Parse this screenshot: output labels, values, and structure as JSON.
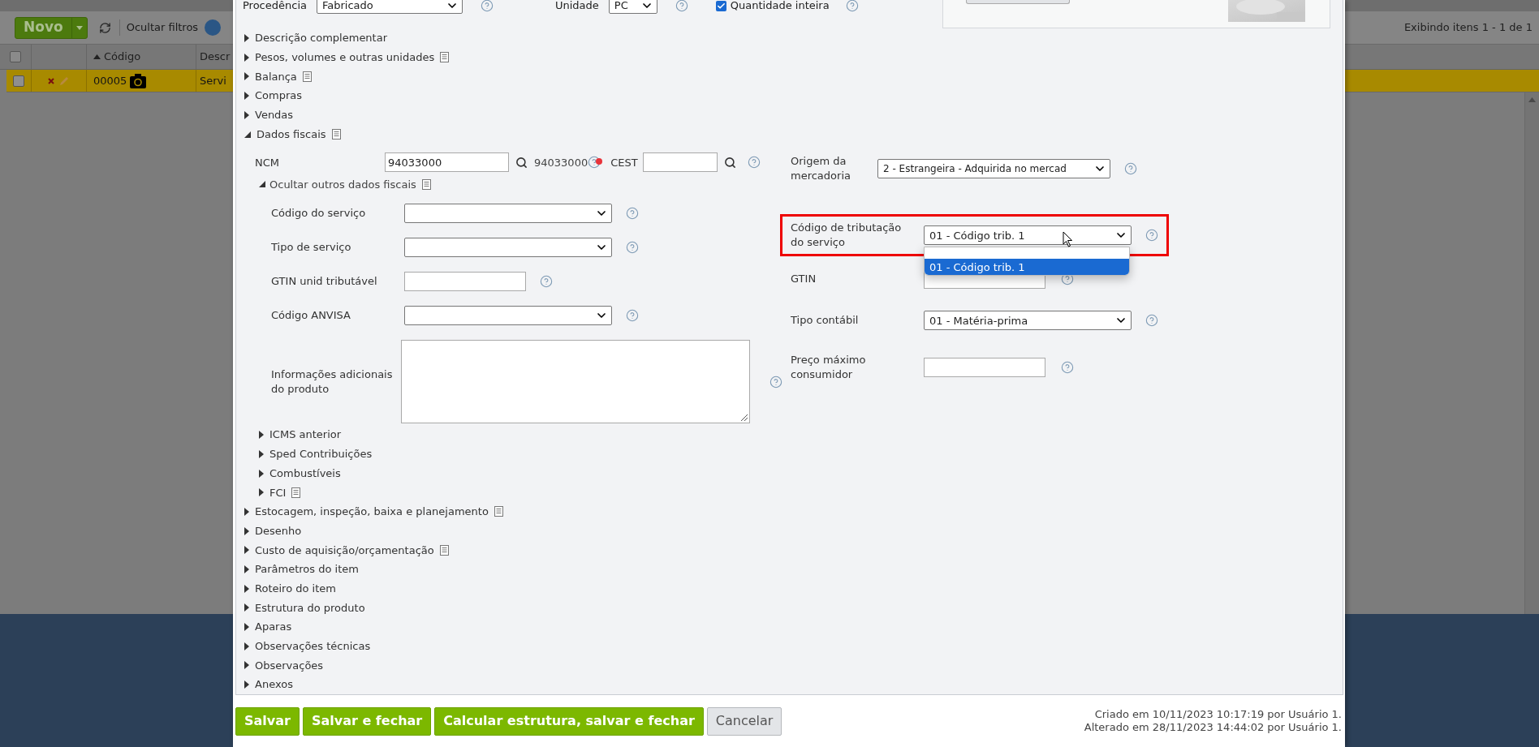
{
  "list_page": {
    "toolbar": {
      "new_button": "Novo",
      "hide_filters_button": "Ocultar filtros"
    },
    "pager": "Exibindo itens 1 - 1 de 1",
    "table": {
      "select_all_checked": false,
      "columns": [
        {
          "label": "Código",
          "sorted": true
        },
        {
          "label": "Descr",
          "sorted": false
        }
      ],
      "rows": [
        {
          "checked": false,
          "selected": true,
          "code": "00005",
          "description": "Servi"
        }
      ]
    }
  },
  "dialog": {
    "top_fields": [
      {
        "label": "Procedência",
        "kind": "select",
        "value": "Fabricado"
      },
      {
        "label": "Unidade",
        "kind": "select",
        "value": "PC"
      },
      {
        "label": "Quantidade inteira",
        "kind": "checkbox",
        "checked": true
      }
    ],
    "sections": [
      {
        "label": "Descrição complementar",
        "expanded": false,
        "note": false
      },
      {
        "label": "Pesos, volumes e outras unidades",
        "expanded": false,
        "note": true
      },
      {
        "label": "Balança",
        "expanded": false,
        "note": true
      },
      {
        "label": "Compras",
        "expanded": false,
        "note": false
      },
      {
        "label": "Vendas",
        "expanded": false,
        "note": false
      },
      {
        "label": "Dados fiscais",
        "expanded": true,
        "note": true,
        "fiscal": {
          "ncm": {
            "label": "NCM",
            "value": "94033000",
            "code": "94033000",
            "alert": true
          },
          "cest_label": "CEST",
          "more": {
            "label": "Ocultar outros dados fiscais",
            "expanded": true,
            "note": true
          },
          "left_fields": [
            {
              "label": "Código do serviço",
              "kind": "select"
            },
            {
              "label": "Tipo de serviço",
              "kind": "select"
            },
            {
              "label": "GTIN unid tributável",
              "kind": "text"
            },
            {
              "label": "Código ANVISA",
              "kind": "select"
            },
            {
              "label": "Informações adicionais do produto",
              "kind": "textarea"
            }
          ],
          "subsections": [
            {
              "label": "ICMS anterior",
              "expanded": false,
              "note": false
            },
            {
              "label": "Sped Contribuições",
              "expanded": false,
              "note": false
            },
            {
              "label": "Combustíveis",
              "expanded": false,
              "note": false
            },
            {
              "label": "FCI",
              "expanded": false,
              "note": true
            }
          ],
          "right_fields": [
            {
              "label": "Origem da mercadoria",
              "kind": "select",
              "value": "2 - Estrangeira - Adquirida no mercad"
            },
            {
              "label": "Código de tributação do serviço",
              "kind": "select",
              "value": "01 - Código trib. 1",
              "highlighted": true,
              "open": true,
              "options": [
                {
                  "blank": true,
                  "selected": false
                },
                {
                  "label": "01 - Código trib. 1",
                  "selected": true
                }
              ]
            },
            {
              "label": "GTIN",
              "kind": "text"
            },
            {
              "label": "Tipo contábil",
              "kind": "select",
              "value": "01 - Matéria-prima"
            },
            {
              "label": "Preço máximo consumidor",
              "kind": "text"
            }
          ]
        }
      },
      {
        "label": "Estocagem, inspeção, baixa e planejamento",
        "expanded": false,
        "note": true
      },
      {
        "label": "Desenho",
        "expanded": false,
        "note": false
      },
      {
        "label": "Custo de aquisição/orçamentação",
        "expanded": false,
        "note": true
      },
      {
        "label": "Parâmetros do item",
        "expanded": false,
        "note": false
      },
      {
        "label": "Roteiro do item",
        "expanded": false,
        "note": false
      },
      {
        "label": "Estrutura do produto",
        "expanded": false,
        "note": false
      },
      {
        "label": "Aparas",
        "expanded": false,
        "note": false
      },
      {
        "label": "Observações técnicas",
        "expanded": false,
        "note": false
      },
      {
        "label": "Observações",
        "expanded": false,
        "note": false
      },
      {
        "label": "Anexos",
        "expanded": false,
        "note": false
      }
    ],
    "buttons": [
      {
        "label": "Salvar",
        "kind": "primary"
      },
      {
        "label": "Salvar e fechar",
        "kind": "primary"
      },
      {
        "label": "Calcular estrutura, salvar e fechar",
        "kind": "primary"
      },
      {
        "label": "Cancelar",
        "kind": "secondary"
      }
    ],
    "audit": [
      "Criado em 10/11/2023 10:17:19 por Usuário 1.",
      "Alterado em 28/11/2023 14:44:02 por Usuário 1."
    ]
  }
}
